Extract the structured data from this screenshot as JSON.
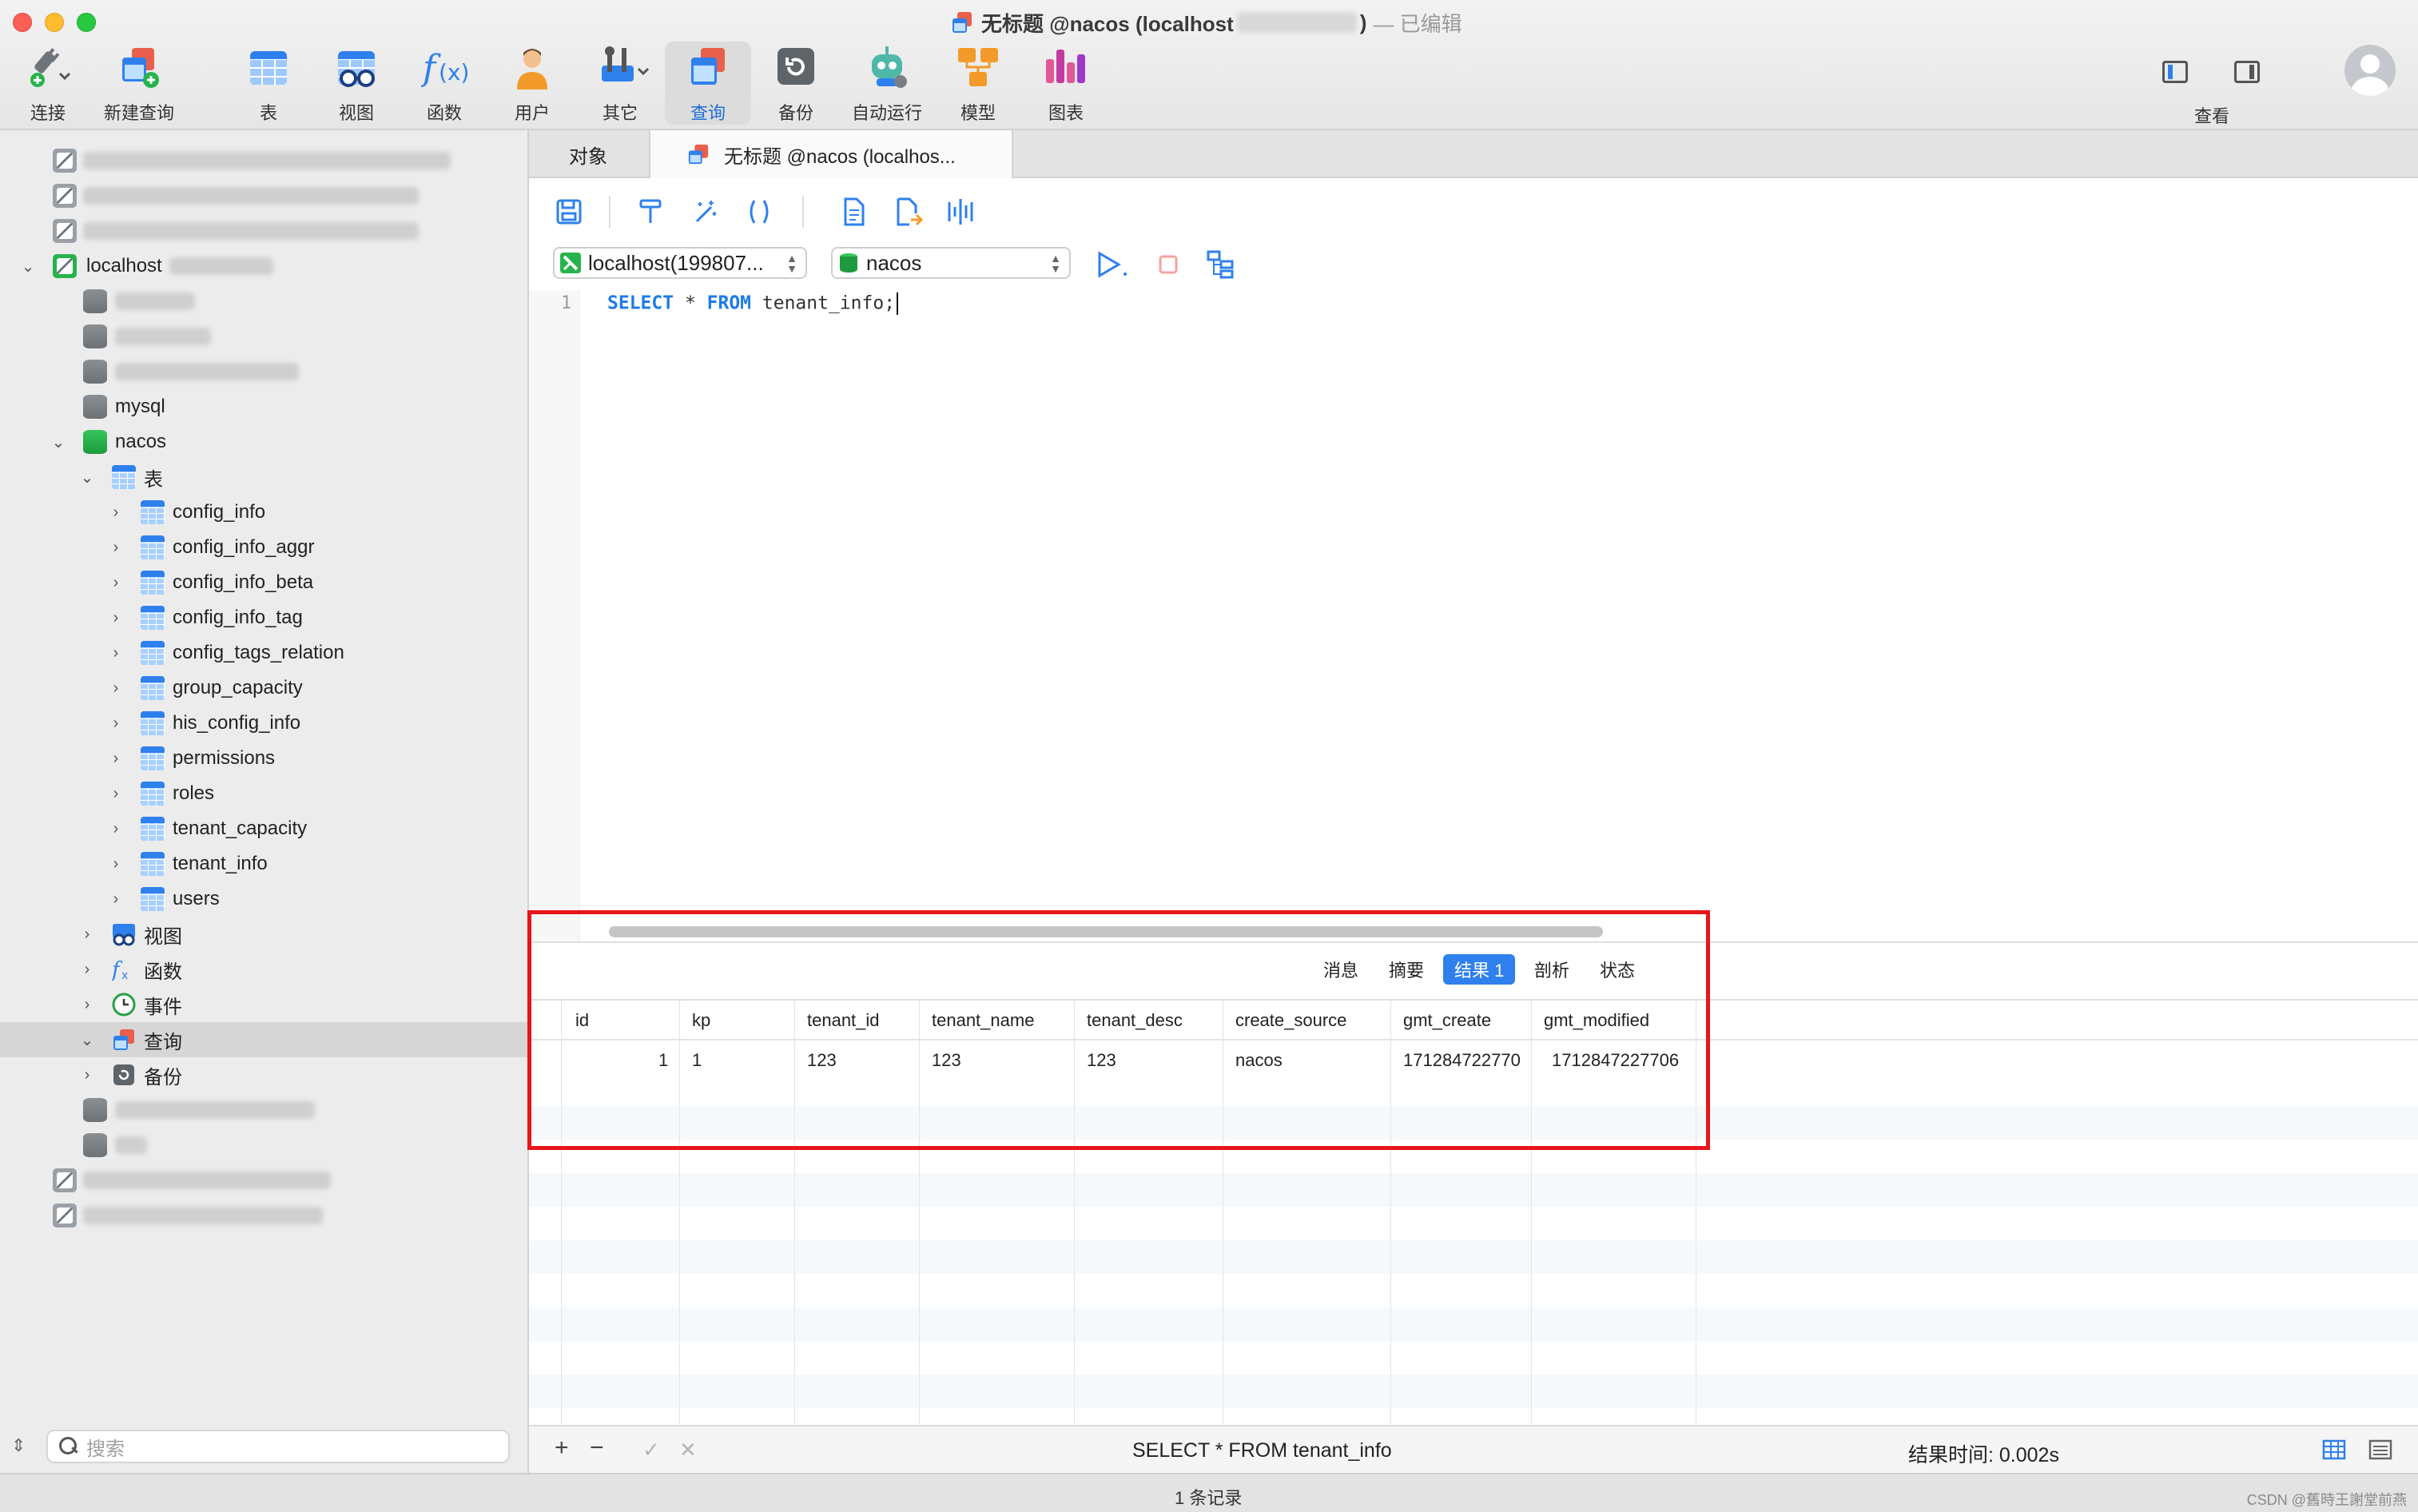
{
  "window": {
    "title_main": "无标题 @nacos (localhost",
    "title_close": ")",
    "title_suffix": "— 已编辑"
  },
  "toolbar": {
    "connect": "连接",
    "new_query": "新建查询",
    "table": "表",
    "view": "视图",
    "function": "函数",
    "user": "用户",
    "other": "其它",
    "query": "查询",
    "backup": "备份",
    "auto_run": "自动运行",
    "model": "模型",
    "chart": "图表",
    "look": "查看"
  },
  "sidebar": {
    "connection_localhost": "localhost",
    "db_mysql": "mysql",
    "db_nacos": "nacos",
    "group_tables": "表",
    "tables": [
      "config_info",
      "config_info_aggr",
      "config_info_beta",
      "config_info_tag",
      "config_tags_relation",
      "group_capacity",
      "his_config_info",
      "permissions",
      "roles",
      "tenant_capacity",
      "tenant_info",
      "users"
    ],
    "group_views": "视图",
    "group_functions": "函数",
    "group_events": "事件",
    "group_queries": "查询",
    "group_backups": "备份",
    "search_placeholder": "搜索"
  },
  "tabs": {
    "objects": "对象",
    "query_tab": "无标题 @nacos (localhos..."
  },
  "editor": {
    "connection_select": "localhost(199807...",
    "database_select": "nacos",
    "line_number": "1",
    "kw_select": "SELECT",
    "star": " * ",
    "kw_from": "FROM",
    "rest": " tenant_info;"
  },
  "results": {
    "tabs": [
      "消息",
      "摘要",
      "结果 1",
      "剖析",
      "状态"
    ],
    "active_tab": "结果 1",
    "columns": [
      "id",
      "kp",
      "tenant_id",
      "tenant_name",
      "tenant_desc",
      "create_source",
      "gmt_create",
      "gmt_modified"
    ],
    "rows": [
      [
        "1",
        "1",
        "123",
        "123",
        "123",
        "nacos",
        "171284722770",
        "1712847227706"
      ]
    ]
  },
  "bottom": {
    "add": "+",
    "remove": "−",
    "apply": "✓",
    "discard": "✕",
    "sql": "SELECT * FROM tenant_info",
    "time": "结果时间: 0.002s"
  },
  "status": {
    "records": "1 条记录",
    "watermark": "CSDN @舊時王謝堂前燕"
  },
  "colors": {
    "accent": "#2f80ed",
    "highlight_box": "#e8151b",
    "keyword": "#1f7ce6"
  }
}
